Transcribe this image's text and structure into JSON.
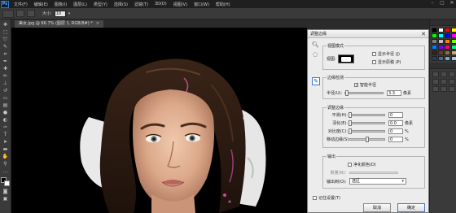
{
  "app": {
    "logo": "Ps"
  },
  "menu": [
    "文件(F)",
    "编辑(E)",
    "图像(I)",
    "图层(L)",
    "类型(Y)",
    "选择(S)",
    "滤镜(T)",
    "3D(D)",
    "视图(V)",
    "窗口(W)",
    "帮助(H)"
  ],
  "window_controls": {
    "minimize": "–",
    "restore": "▢",
    "close": "✕"
  },
  "options_bar": {
    "size_label": "大小:",
    "size_value": "10"
  },
  "document": {
    "tab_label": "美女.jpg @ 66.7% (图层 1, RGB/8#) *",
    "close": "×"
  },
  "dialog": {
    "title": "调整边缘",
    "close": "✕",
    "view_mode": {
      "group_title": "视图模式",
      "view_label": "视图:",
      "show_radius": {
        "label": "显示半径 (J)",
        "checked": false
      },
      "show_original": {
        "label": "显示原稿 (P)",
        "checked": false
      }
    },
    "edge_detection": {
      "group_title": "边缘检测",
      "smart_radius": {
        "label": "智能半径",
        "checked": true
      },
      "radius": {
        "label": "半径(U):",
        "value": "3.3",
        "unit": "像素",
        "level": 0.05
      }
    },
    "adjust_edge": {
      "group_title": "调整边缘",
      "rows": [
        {
          "label": "平滑(H):",
          "value": "0",
          "unit": "",
          "level": 0.0
        },
        {
          "label": "羽化(E):",
          "value": "0.0",
          "unit": "像素",
          "level": 0.0
        },
        {
          "label": "对比度(C):",
          "value": "0",
          "unit": "%",
          "level": 0.0
        },
        {
          "label": "移动边缘(S):",
          "value": "0",
          "unit": "%",
          "level": 0.5
        }
      ]
    },
    "output": {
      "group_title": "输出",
      "decontaminate": {
        "label": "净化颜色(D)",
        "checked": false
      },
      "amount_label": "数量(N):",
      "output_to_label": "输出到(O):",
      "output_to_value": "选区"
    },
    "remember": {
      "label": "记住设置(T)",
      "checked": false
    },
    "cancel_label": "取消",
    "ok_label": "确定"
  },
  "colors": {
    "swatches": [
      "#000000",
      "#ffffff",
      "#ff0000",
      "#ffff00",
      "#00ff00",
      "#00ffff",
      "#0000ff",
      "#ff00ff",
      "#7f7f7f",
      "#c0c0c0",
      "#ff7f00",
      "#7fff00",
      "#007fff",
      "#7f00ff",
      "#ff007f",
      "#00ff7f",
      "#3f1f0f",
      "#6a3d1f",
      "#9a6b3c",
      "#d4a574",
      "#1f3f6a",
      "#3c6b9a",
      "#74a5d4",
      "#a5c8e8"
    ]
  }
}
